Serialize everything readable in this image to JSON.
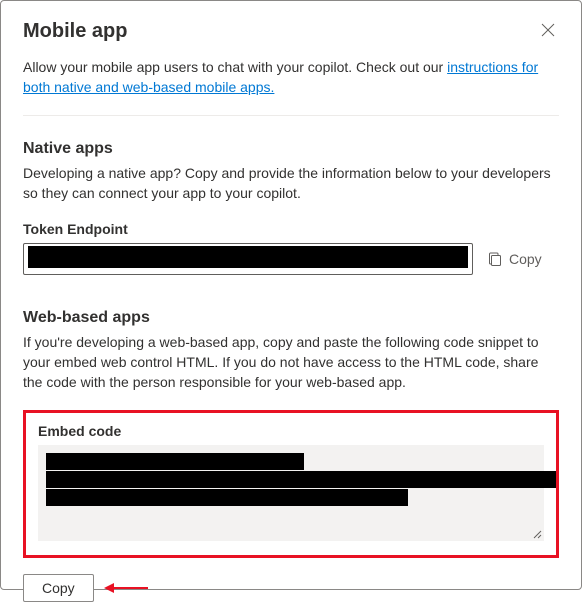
{
  "header": {
    "title": "Mobile app"
  },
  "intro": {
    "text_before_link": "Allow your mobile app users to chat with your copilot. Check out our ",
    "link_text": "instructions for both native and web-based mobile apps."
  },
  "native_section": {
    "heading": "Native apps",
    "description": "Developing a native app? Copy and provide the information below to your developers so they can connect your app to your copilot.",
    "token_label": "Token Endpoint",
    "copy_label": "Copy"
  },
  "web_section": {
    "heading": "Web-based apps",
    "description": "If you're developing a web-based app, copy and paste the following code snippet to your embed web control HTML. If you do not have access to the HTML code, share the code with the person responsible for your web-based app.",
    "embed_label": "Embed code",
    "copy_button": "Copy"
  }
}
